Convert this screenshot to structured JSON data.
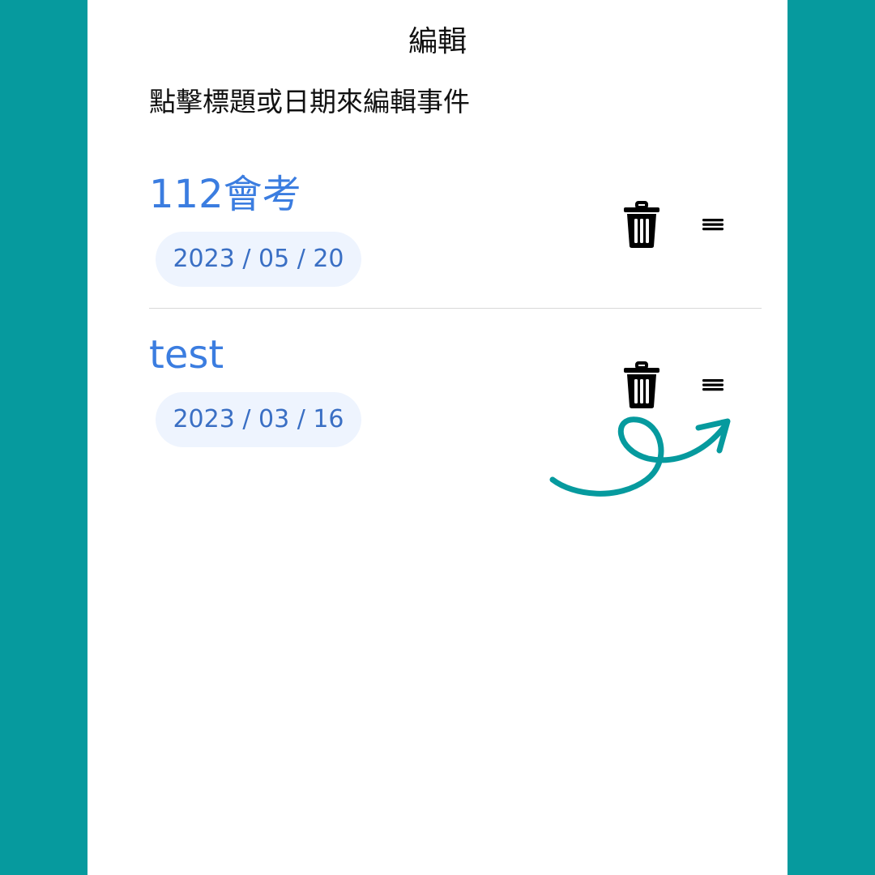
{
  "header": {
    "title": "編輯"
  },
  "hint": "點擊標題或日期來編輯事件",
  "events": [
    {
      "title": "112會考",
      "date": "2023 / 05 / 20"
    },
    {
      "title": "test",
      "date": "2023 / 03 / 16"
    }
  ],
  "icons": {
    "delete": "trash-icon",
    "reorder": "drag-handle-icon",
    "annotation": "curved-arrow-icon"
  },
  "colors": {
    "frame": "#069a9e",
    "accent": "#3b7de0",
    "date_pill": "#eef4fe",
    "annotation": "#069a9e"
  }
}
